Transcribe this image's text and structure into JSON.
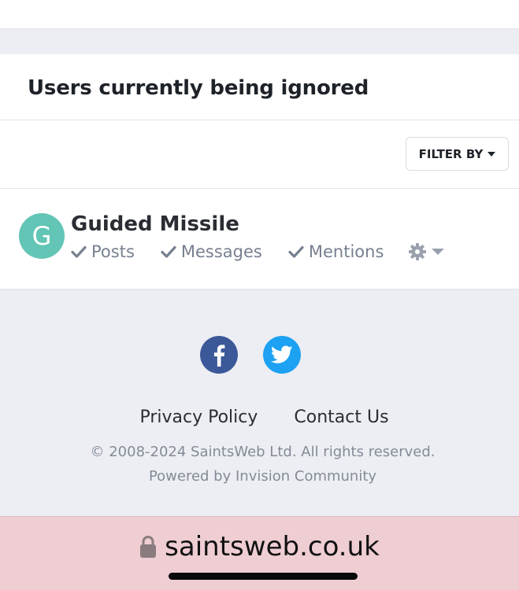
{
  "section": {
    "title": "Users currently being ignored"
  },
  "filter": {
    "label": "FILTER BY"
  },
  "user": {
    "initial": "G",
    "name": "Guided Missile",
    "avatar_color": "#62c5b5",
    "prefs": [
      {
        "label": "Posts",
        "icon": "check-icon"
      },
      {
        "label": "Messages",
        "icon": "check-icon"
      },
      {
        "label": "Mentions",
        "icon": "check-icon"
      }
    ],
    "settings_icon": "gear-icon"
  },
  "social": [
    {
      "name": "facebook-icon",
      "color": "#3b5998"
    },
    {
      "name": "twitter-icon",
      "color": "#1da1f2"
    }
  ],
  "footer": {
    "links": [
      "Privacy Policy",
      "Contact Us"
    ],
    "copyright": "© 2008-2024 SaintsWeb Ltd. All rights reserved.",
    "powered_by": "Powered by Invision Community"
  },
  "browser": {
    "url": "saintsweb.co.uk",
    "bar_color": "#eecdd3"
  }
}
